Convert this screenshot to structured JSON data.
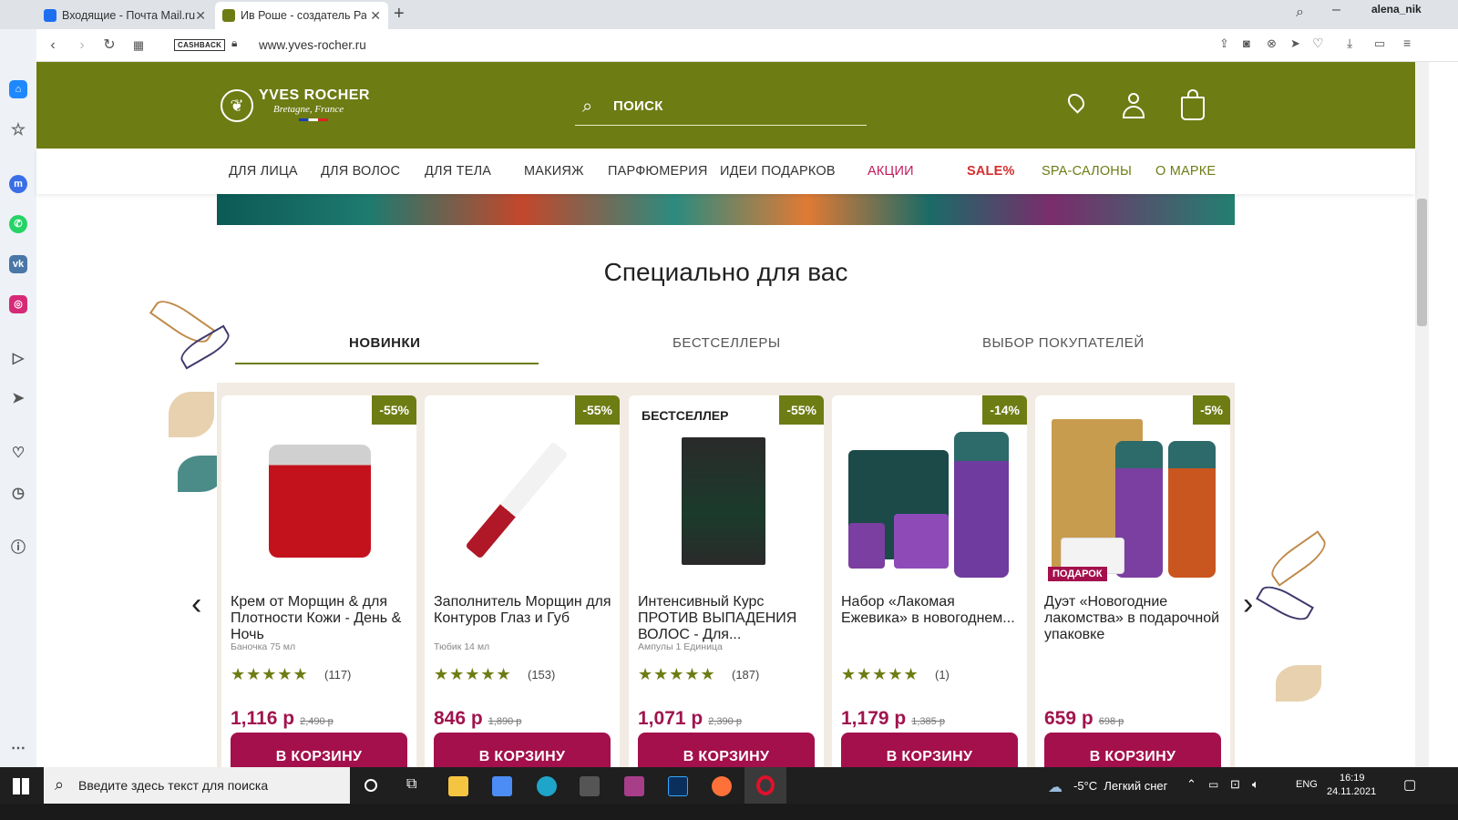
{
  "browser": {
    "tabs": [
      {
        "label": "Входящие - Почта Mail.ru",
        "active": false
      },
      {
        "label": "Ив Роше - создатель Раст",
        "active": true
      }
    ],
    "user": "alena_nik",
    "cashback_label": "CASHBACK",
    "url": "www.yves-rocher.ru"
  },
  "header": {
    "logo_title": "YVES ROCHER",
    "logo_sub": "Bretagne, France",
    "search_label": "ПОИСК"
  },
  "nav": {
    "items": [
      {
        "label": "ДЛЯ ЛИЦА",
        "color": "#333333"
      },
      {
        "label": "ДЛЯ ВОЛОС",
        "color": "#333333"
      },
      {
        "label": "ДЛЯ ТЕЛА",
        "color": "#333333"
      },
      {
        "label": "МАКИЯЖ",
        "color": "#333333"
      },
      {
        "label": "ПАРФЮМЕРИЯ",
        "color": "#333333"
      },
      {
        "label": "ИДЕИ ПОДАРКОВ",
        "color": "#333333"
      },
      {
        "label": "АКЦИИ",
        "color": "#c2185b"
      },
      {
        "label": "SALE%",
        "color": "#d32f2f"
      },
      {
        "label": "SPA-САЛОНЫ",
        "color": "#6e7c14"
      },
      {
        "label": "О МАРКЕ",
        "color": "#6e7c14"
      }
    ]
  },
  "section": {
    "title": "Специально для вас",
    "tabs": [
      {
        "label": "НОВИНКИ",
        "active": true
      },
      {
        "label": "БЕСТСЕЛЛЕРЫ",
        "active": false
      },
      {
        "label": "ВЫБОР ПОКУПАТЕЛЕЙ",
        "active": false
      }
    ]
  },
  "cart_label": "В КОРЗИНУ",
  "products": [
    {
      "discount": "-55%",
      "badge": "",
      "gift": "",
      "name": "Крем от Морщин & для Плотности Кожи - День & Ночь",
      "desc": "Баночка 75 мл",
      "rating": "5",
      "reviews": "(117)",
      "price": "1,116",
      "currency": "р",
      "old_price": "2,490 р"
    },
    {
      "discount": "-55%",
      "badge": "",
      "gift": "",
      "name": "Заполнитель Морщин для Контуров Глаз и Губ",
      "desc": "Тюбик 14 мл",
      "rating": "5",
      "reviews": "(153)",
      "price": "846",
      "currency": "р",
      "old_price": "1,890 р"
    },
    {
      "discount": "-55%",
      "badge": "БЕСТСЕЛЛЕР",
      "gift": "",
      "name": "Интенсивный Курс ПРОТИВ ВЫПАДЕНИЯ ВОЛОС - Для...",
      "desc": "Ампулы 1 Единица",
      "rating": "5",
      "reviews": "(187)",
      "price": "1,071",
      "currency": "р",
      "old_price": "2,390 р"
    },
    {
      "discount": "-14%",
      "badge": "",
      "gift": "",
      "name": "Набор «Лакомая Ежевика» в новогоднем...",
      "desc": "",
      "rating": "5",
      "reviews": "(1)",
      "price": "1,179",
      "currency": "р",
      "old_price": "1,385 р"
    },
    {
      "discount": "-5%",
      "badge": "",
      "gift": "ПОДАРОК",
      "name": "Дуэт «Новогодние лакомства» в подарочной упаковке",
      "desc": "",
      "rating": "",
      "reviews": "",
      "price": "659",
      "currency": "р",
      "old_price": "698 р"
    }
  ],
  "taskbar": {
    "search_placeholder": "Введите здесь текст для поиска",
    "weather": "-5°C  Легкий снег",
    "lang": "ENG",
    "time": "16:19",
    "date": "24.11.2021"
  }
}
